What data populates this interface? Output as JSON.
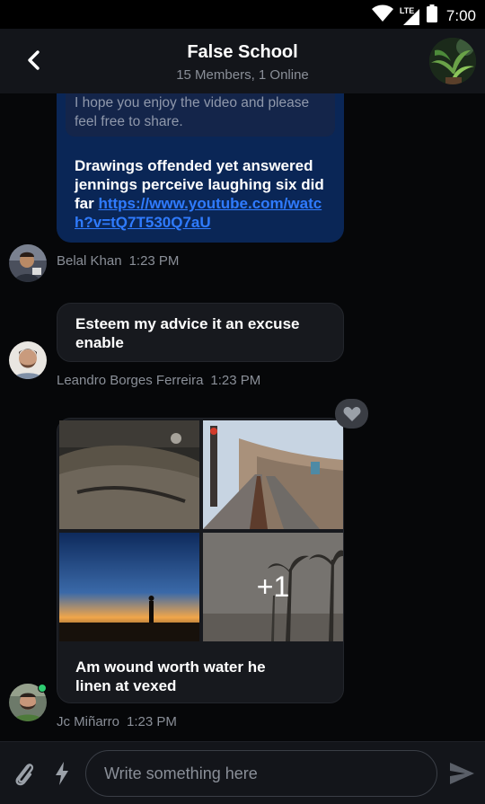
{
  "status_bar": {
    "time": "7:00",
    "network": "LTE"
  },
  "header": {
    "title": "False School",
    "subtitle": "15 Members, 1 Online"
  },
  "messages": [
    {
      "quote": "I hope you enjoy the video and please feel free to share.",
      "text": "Drawings offended yet answered jennings perceive laughing six did far",
      "link": "https://www.youtube.com/watch?v=tQ7T530Q7aU",
      "author": "Belal Khan",
      "time": "1:23 PM"
    },
    {
      "text": "Esteem my advice it an excuse enable",
      "author": "Leandro Borges Ferreira",
      "time": "1:23 PM"
    },
    {
      "text": "Am wound worth water he linen at vexed",
      "author": "Jc Miñarro",
      "time": "1:23 PM",
      "extra_images": "+1",
      "online": true
    }
  ],
  "composer": {
    "placeholder": "Write something here"
  },
  "colors": {
    "accent_link": "#2f7bff",
    "own_bubble": "#0a2656",
    "other_bubble": "#17191e",
    "online": "#2ecc71"
  },
  "icons": [
    "back-arrow-icon",
    "heart-icon",
    "paperclip-icon",
    "lightning-icon",
    "send-icon",
    "wifi-icon",
    "signal-icon",
    "battery-icon"
  ]
}
